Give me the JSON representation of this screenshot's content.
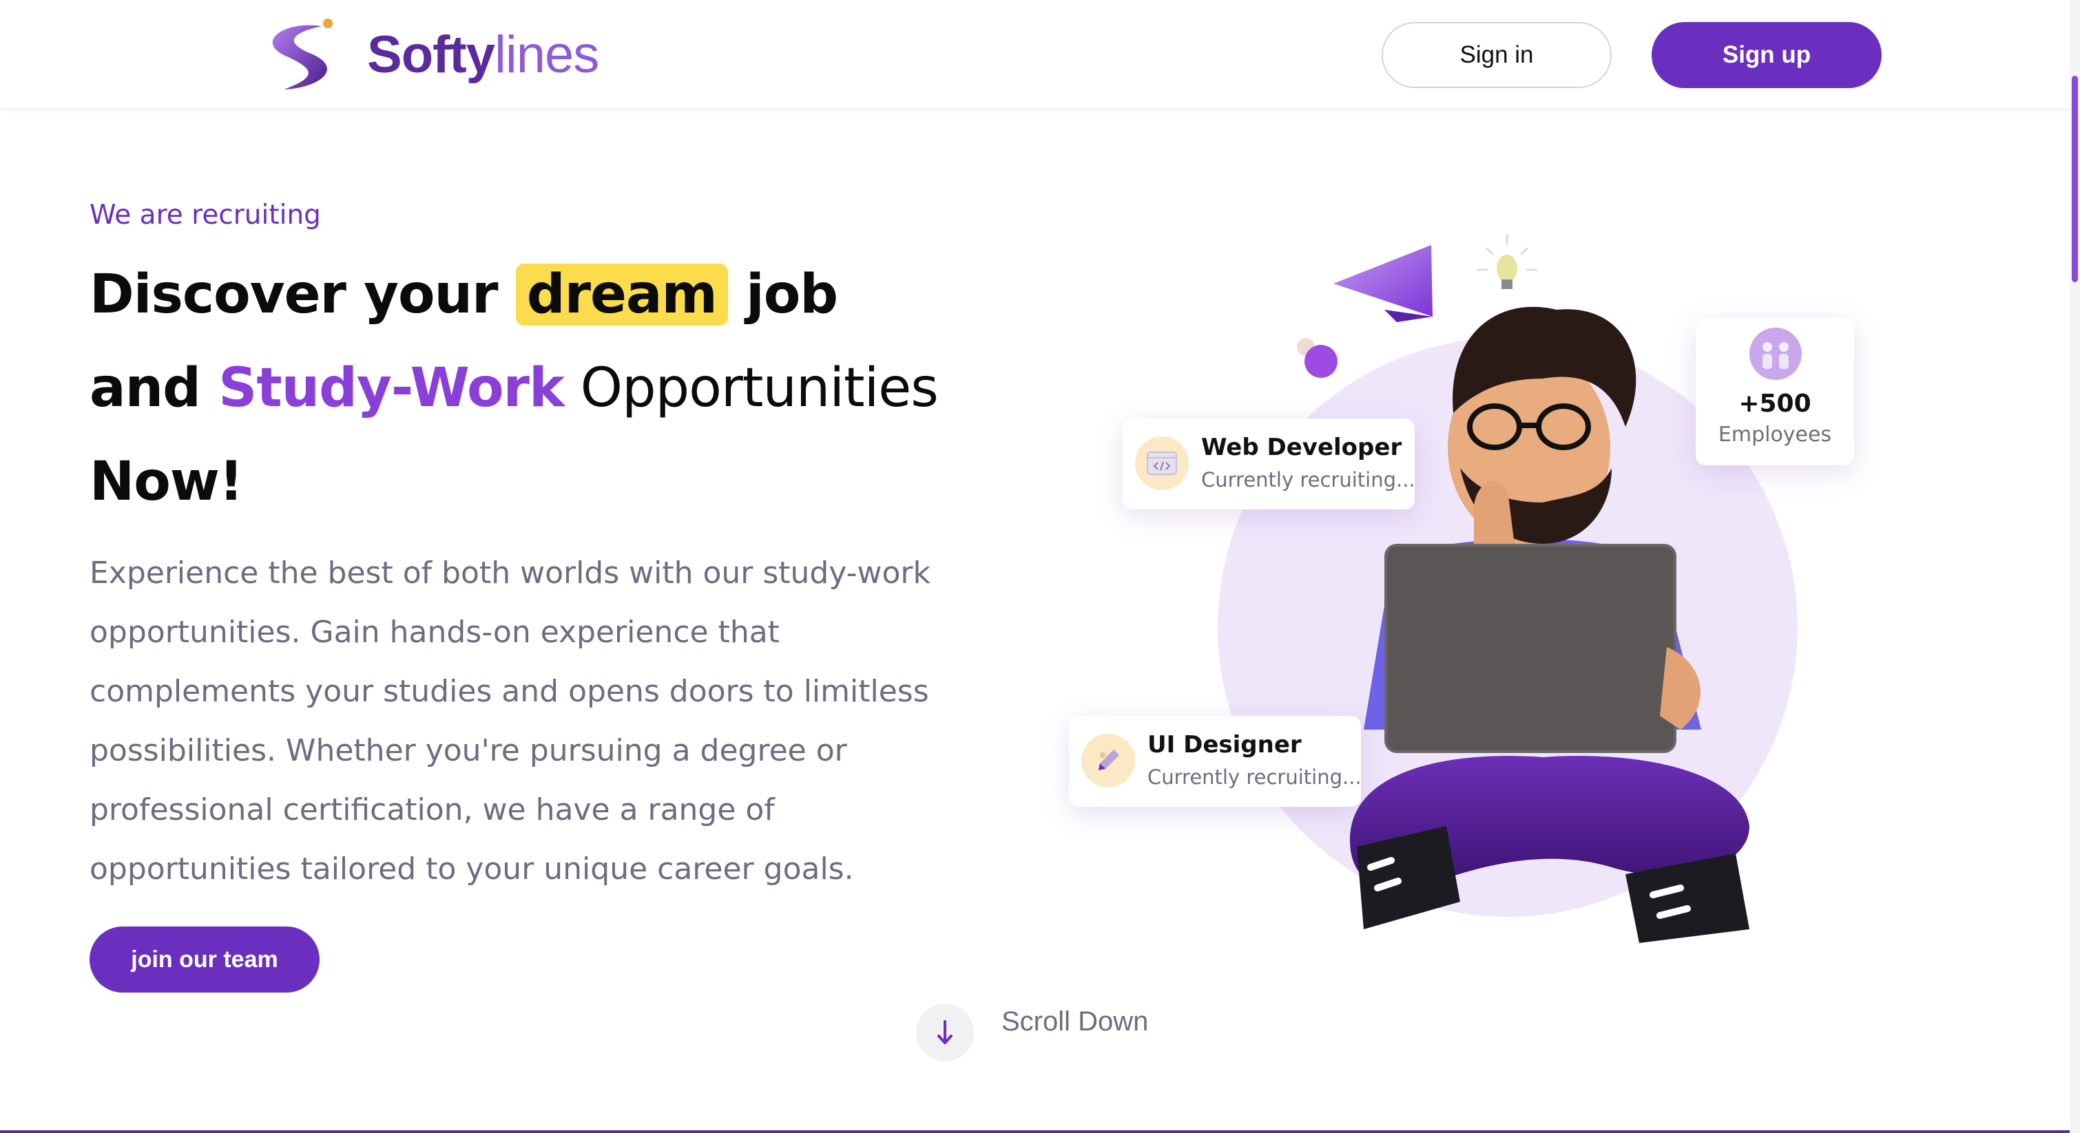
{
  "header": {
    "brand_bold": "Softy",
    "brand_light": "lines",
    "signin_label": "Sign in",
    "signup_label": "Sign up"
  },
  "hero": {
    "eyebrow": "We are recruiting",
    "headline": {
      "part1": "Discover your ",
      "highlight_yellow": "dream",
      "part2": " job",
      "part3": "and ",
      "highlight_purple": "Study-Work",
      "part4": " Opportunities",
      "part5": "Now!"
    },
    "description": "Experience the best of both worlds with our study-work opportunities. Gain hands-on experience that complements your studies and opens doors to limitless possibilities. Whether you're pursuing a degree or professional certification, we have a range of opportunities tailored to your unique career goals.",
    "cta_label": "join our team",
    "scroll_label": "Scroll Down"
  },
  "cards": {
    "web_dev": {
      "title": "Web Developer",
      "subtitle": "Currently recruiting..."
    },
    "ui_designer": {
      "title": "UI Designer",
      "subtitle": "Currently recruiting..."
    },
    "employees": {
      "count": "+500",
      "label": "Employees"
    }
  },
  "icons": {
    "logo": "softylines-swoosh-logo",
    "scroll": "arrow-down-icon",
    "web_dev": "code-window-icon",
    "ui_designer": "pen-tool-icon",
    "employees": "team-avatar-icon"
  },
  "colors": {
    "primary": "#6a2fbf",
    "accent_purple": "#8a3fd9",
    "highlight_yellow": "#fbdc4c",
    "body_text": "#6f6b80",
    "bubble_bg": "#efe6fa"
  }
}
